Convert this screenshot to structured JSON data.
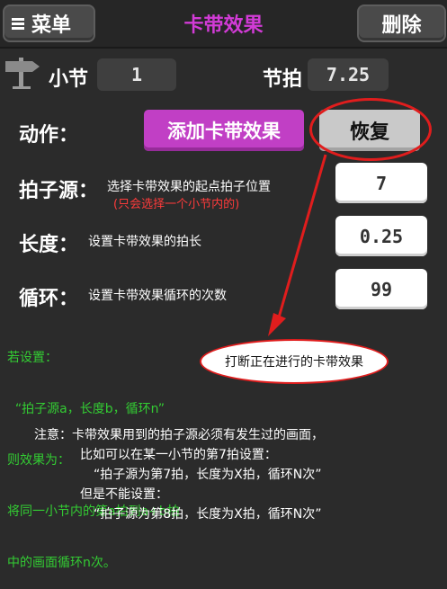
{
  "header": {
    "menu_label": "菜单",
    "title": "卡带效果",
    "delete_label": "删除",
    "title_color": "#d23bd6"
  },
  "position": {
    "bar_label": "小节",
    "bar_value": "1",
    "beat_label": "节拍",
    "beat_value": "7.25"
  },
  "action": {
    "label": "动作：",
    "add_button": "添加卡带效果",
    "restore_button": "恢复",
    "add_button_color": "#c13fc5"
  },
  "params": [
    {
      "label": "拍子源：",
      "desc": "选择卡带效果的起点拍子位置",
      "hint": "(只会选择一个小节内的)",
      "value": "7"
    },
    {
      "label": "长度：",
      "desc": "设置卡带效果的拍长",
      "value": "0.25"
    },
    {
      "label": "循环：",
      "desc": "设置卡带效果循环的次数",
      "value": "99"
    }
  ],
  "example": {
    "lines": [
      "若设置：",
      "  “拍子源a，长度b，循环n”",
      "则效果为：",
      "将同一小节内的第a拍到a+b拍",
      "中的画面循环n次。"
    ]
  },
  "annotation": {
    "text": "打断正在进行的卡带效果"
  },
  "note": {
    "lines": [
      "注意：卡带效果用到的拍子源必须有发生过的画面，",
      "比如可以在某一小节的第7拍设置：",
      "“拍子源为第7拍，长度为X拍，循环N次”",
      "但是不能设置：",
      "“拍子源为第8拍，长度为X拍，循环N次”"
    ]
  }
}
